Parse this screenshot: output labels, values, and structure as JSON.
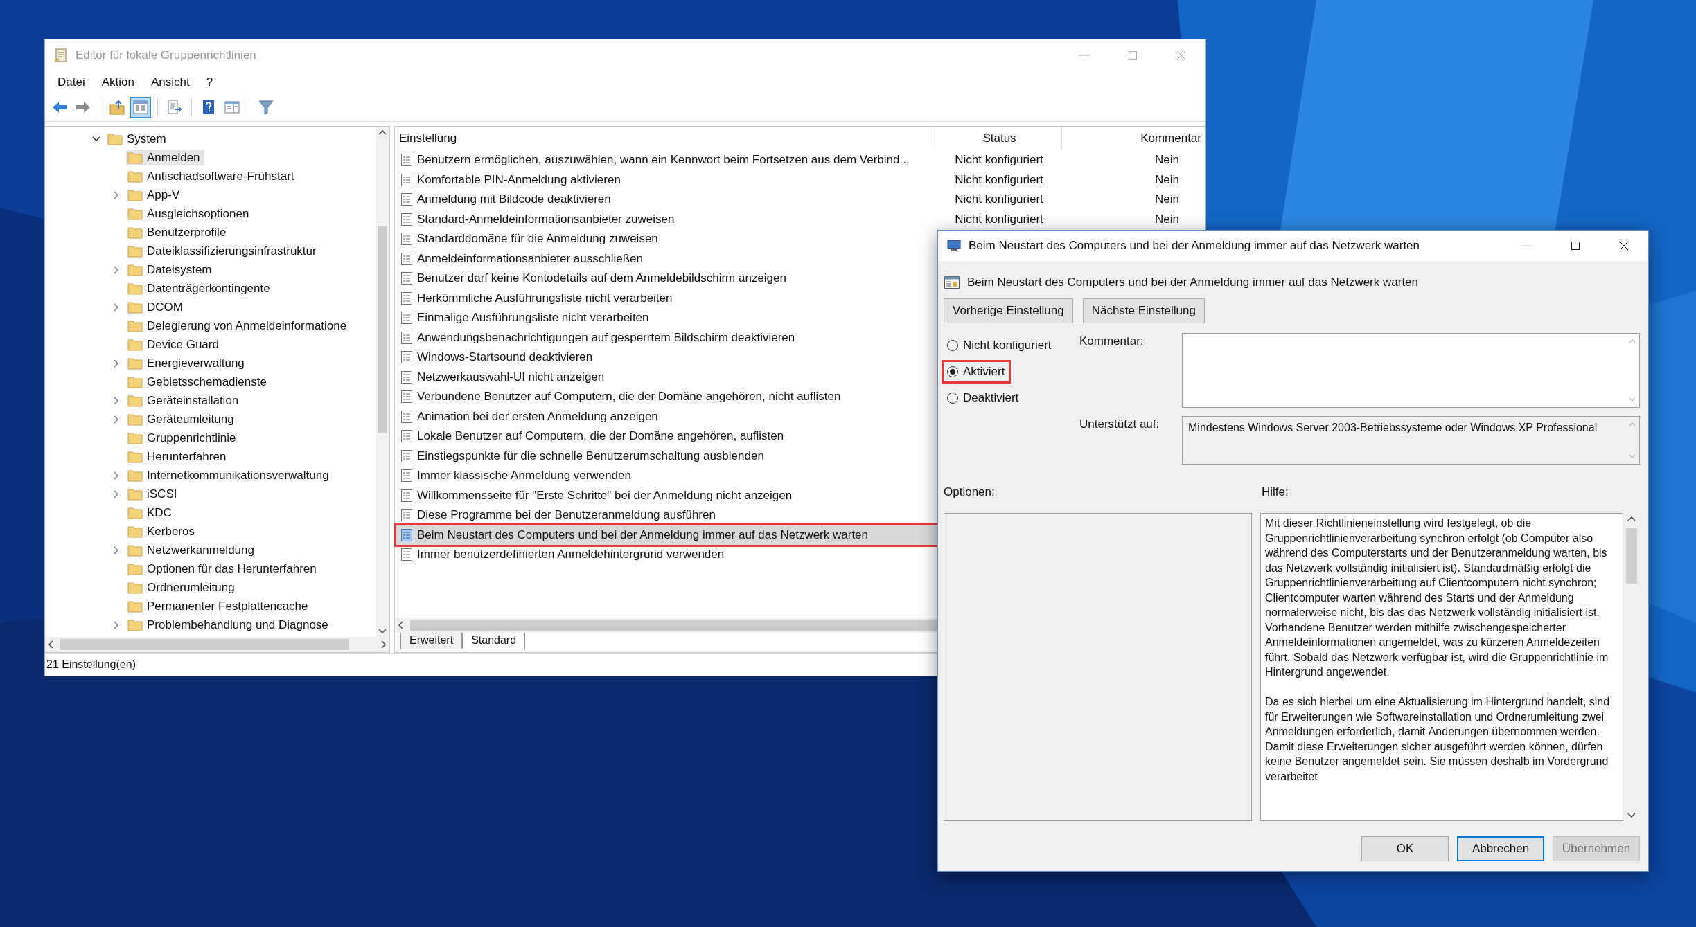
{
  "main_window": {
    "title": "Editor für lokale Gruppenrichtlinien",
    "menu": [
      "Datei",
      "Aktion",
      "Ansicht",
      "?"
    ],
    "toolbar": [
      [
        {
          "kind": "back",
          "pressed": false
        },
        {
          "kind": "forward",
          "pressed": false
        }
      ],
      [
        {
          "kind": "up",
          "pressed": false
        },
        {
          "kind": "tree",
          "pressed": true
        }
      ],
      [
        {
          "kind": "export",
          "pressed": false
        }
      ],
      [
        {
          "kind": "help",
          "pressed": false
        },
        {
          "kind": "pane",
          "pressed": false
        }
      ],
      [
        {
          "kind": "filter",
          "pressed": false
        }
      ]
    ],
    "tree": [
      {
        "label": "System",
        "expanded": true,
        "selected": false,
        "children": [
          {
            "label": "Anmelden",
            "expandable": false,
            "selected": true
          },
          {
            "label": "Antischadsoftware-Frühstart",
            "expandable": false,
            "selected": false
          },
          {
            "label": "App-V",
            "expandable": true,
            "selected": false
          },
          {
            "label": "Ausgleichsoptionen",
            "expandable": false,
            "selected": false
          },
          {
            "label": "Benutzerprofile",
            "expandable": false,
            "selected": false
          },
          {
            "label": "Dateiklassifizierungsinfrastruktur",
            "expandable": false,
            "selected": false
          },
          {
            "label": "Dateisystem",
            "expandable": true,
            "selected": false
          },
          {
            "label": "Datenträgerkontingente",
            "expandable": false,
            "selected": false
          },
          {
            "label": "DCOM",
            "expandable": true,
            "selected": false
          },
          {
            "label": "Delegierung von Anmeldeinformatione",
            "expandable": false,
            "selected": false
          },
          {
            "label": "Device Guard",
            "expandable": false,
            "selected": false
          },
          {
            "label": "Energieverwaltung",
            "expandable": true,
            "selected": false
          },
          {
            "label": "Gebietsschemadienste",
            "expandable": false,
            "selected": false
          },
          {
            "label": "Geräteinstallation",
            "expandable": true,
            "selected": false
          },
          {
            "label": "Geräteumleitung",
            "expandable": true,
            "selected": false
          },
          {
            "label": "Gruppenrichtlinie",
            "expandable": false,
            "selected": false
          },
          {
            "label": "Herunterfahren",
            "expandable": false,
            "selected": false
          },
          {
            "label": "Internetkommunikationsverwaltung",
            "expandable": true,
            "selected": false
          },
          {
            "label": "iSCSI",
            "expandable": true,
            "selected": false
          },
          {
            "label": "KDC",
            "expandable": false,
            "selected": false
          },
          {
            "label": "Kerberos",
            "expandable": false,
            "selected": false
          },
          {
            "label": "Netzwerkanmeldung",
            "expandable": true,
            "selected": false
          },
          {
            "label": "Optionen für das Herunterfahren",
            "expandable": false,
            "selected": false
          },
          {
            "label": "Ordnerumleitung",
            "expandable": false,
            "selected": false
          },
          {
            "label": "Permanenter Festplattencache",
            "expandable": false,
            "selected": false
          },
          {
            "label": "Problembehandlung und Diagnose",
            "expandable": true,
            "selected": false
          }
        ]
      }
    ],
    "list": {
      "columns": [
        "Einstellung",
        "Status",
        "Kommentar"
      ],
      "rows": [
        {
          "setting": "Benutzern ermöglichen, auszuwählen, wann ein Kennwort beim Fortsetzen aus dem Verbind...",
          "status": "Nicht konfiguriert",
          "comment": "Nein",
          "selected": false,
          "highlighted": false
        },
        {
          "setting": "Komfortable PIN-Anmeldung aktivieren",
          "status": "Nicht konfiguriert",
          "comment": "Nein",
          "selected": false,
          "highlighted": false
        },
        {
          "setting": "Anmeldung mit Bildcode deaktivieren",
          "status": "Nicht konfiguriert",
          "comment": "Nein",
          "selected": false,
          "highlighted": false
        },
        {
          "setting": "Standard-Anmeldeinformationsanbieter zuweisen",
          "status": "Nicht konfiguriert",
          "comment": "Nein",
          "selected": false,
          "highlighted": false
        },
        {
          "setting": "Standarddomäne für die Anmeldung zuweisen",
          "selected": false,
          "highlighted": false
        },
        {
          "setting": "Anmeldeinformationsanbieter ausschließen",
          "selected": false,
          "highlighted": false
        },
        {
          "setting": "Benutzer darf keine Kontodetails auf dem Anmeldebildschirm anzeigen",
          "selected": false,
          "highlighted": false
        },
        {
          "setting": "Herkömmliche Ausführungsliste nicht verarbeiten",
          "selected": false,
          "highlighted": false
        },
        {
          "setting": "Einmalige Ausführungsliste nicht verarbeiten",
          "selected": false,
          "highlighted": false
        },
        {
          "setting": "Anwendungsbenachrichtigungen auf gesperrtem Bildschirm deaktivieren",
          "selected": false,
          "highlighted": false
        },
        {
          "setting": "Windows-Startsound deaktivieren",
          "selected": false,
          "highlighted": false
        },
        {
          "setting": "Netzwerkauswahl-UI nicht anzeigen",
          "selected": false,
          "highlighted": false
        },
        {
          "setting": "Verbundene Benutzer auf Computern, die der Domäne angehören, nicht auflisten",
          "selected": false,
          "highlighted": false
        },
        {
          "setting": "Animation bei der ersten Anmeldung anzeigen",
          "selected": false,
          "highlighted": false
        },
        {
          "setting": "Lokale Benutzer auf Computern, die der Domäne angehören, auflisten",
          "selected": false,
          "highlighted": false
        },
        {
          "setting": "Einstiegspunkte für die schnelle Benutzerumschaltung ausblenden",
          "selected": false,
          "highlighted": false
        },
        {
          "setting": "Immer klassische Anmeldung verwenden",
          "selected": false,
          "highlighted": false
        },
        {
          "setting": "Willkommensseite für \"Erste Schritte\" bei der Anmeldung nicht anzeigen",
          "selected": false,
          "highlighted": false
        },
        {
          "setting": "Diese Programme bei der Benutzeranmeldung ausführen",
          "selected": false,
          "highlighted": false
        },
        {
          "setting": "Beim Neustart des Computers und bei der Anmeldung immer auf das Netzwerk warten",
          "selected": true,
          "highlighted": true
        },
        {
          "setting": "Immer benutzerdefinierten Anmeldehintergrund verwenden",
          "selected": false,
          "highlighted": false
        }
      ]
    },
    "tabs": [
      {
        "label": "Erweitert",
        "selected": false
      },
      {
        "label": "Standard",
        "selected": true
      }
    ],
    "status_bar": "21 Einstellung(en)"
  },
  "dialog": {
    "title": "Beim Neustart des Computers und bei der Anmeldung immer auf das Netzwerk warten",
    "heading": "Beim Neustart des Computers und bei der Anmeldung immer auf das Netzwerk warten",
    "nav_buttons": [
      "Vorherige Einstellung",
      "Nächste Einstellung"
    ],
    "options": [
      {
        "label": "Nicht konfiguriert",
        "selected": false,
        "highlighted": false
      },
      {
        "label": "Aktiviert",
        "selected": true,
        "highlighted": true
      },
      {
        "label": "Deaktiviert",
        "selected": false,
        "highlighted": false
      }
    ],
    "comment_label": "Kommentar:",
    "supported_label": "Unterstützt auf:",
    "supported_text": "Mindestens Windows Server 2003-Betriebssysteme oder Windows XP Professional",
    "options_label": "Optionen:",
    "help_label": "Hilfe:",
    "help": [
      "Mit dieser Richtlinieneinstellung wird festgelegt, ob die Gruppenrichtlinienverarbeitung synchron erfolgt (ob Computer also während des Computerstarts und der Benutzeranmeldung warten, bis das Netzwerk vollständig initialisiert ist). Standardmäßig erfolgt die Gruppenrichtlinienverarbeitung auf Clientcomputern nicht synchron; Clientcomputer warten während des Starts und der Anmeldung normalerweise nicht, bis das das Netzwerk vollständig initialisiert ist. Vorhandene Benutzer werden mithilfe zwischengespeicherter Anmeldeinformationen angemeldet, was zu kürzeren Anmeldezeiten führt. Sobald das Netzwerk verfügbar ist, wird die Gruppenrichtlinie im Hintergrund angewendet.",
      "Da es sich hierbei um eine Aktualisierung im Hintergrund handelt, sind für Erweiterungen wie Softwareinstallation und Ordnerumleitung zwei Anmeldungen erforderlich, damit Änderungen übernommen werden. Damit diese Erweiterungen sicher ausgeführt werden können, dürfen keine Benutzer angemeldet sein. Sie müssen deshalb im Vordergrund verarbeitet"
    ],
    "buttons": [
      {
        "label": "OK",
        "kind": "normal"
      },
      {
        "label": "Abbrechen",
        "kind": "default"
      },
      {
        "label": "Übernehmen",
        "kind": "disabled"
      }
    ]
  }
}
